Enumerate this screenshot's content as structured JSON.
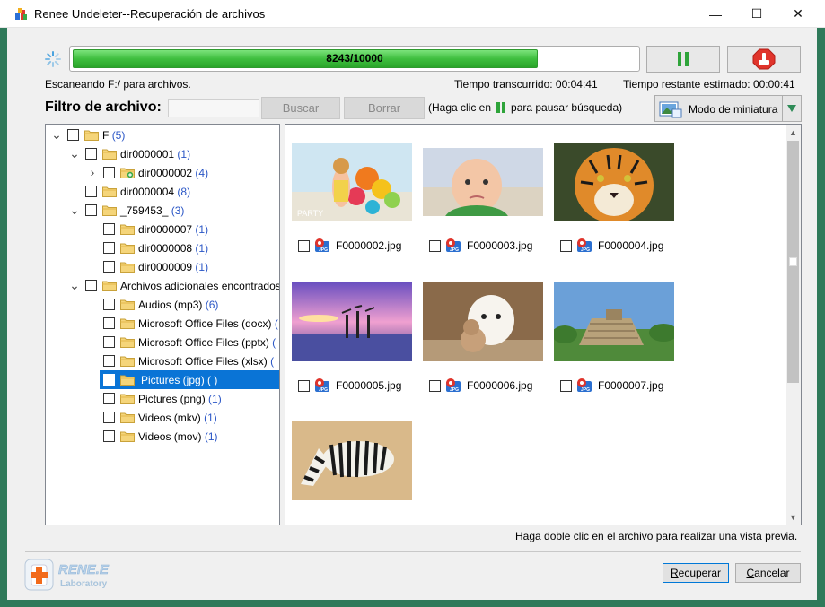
{
  "window": {
    "title": "Renee Undeleter--Recuperación de archivos",
    "minimize": "—",
    "maximize": "☐",
    "close": "✕"
  },
  "progress": {
    "text": "8243/10000",
    "value": 8243,
    "max": 10000,
    "fill_color": "#3fbf3f"
  },
  "status": {
    "scanning": "Escaneando F:/ para archivos.",
    "elapsed": "Tiempo transcurrido: 00:04:41",
    "remaining": "Tiempo restante estimado: 00:00:41"
  },
  "filter": {
    "label": "Filtro de archivo:",
    "input_value": "",
    "search_button": "Buscar",
    "clear_button": "Borrar",
    "hint_before": "(Haga clic en",
    "hint_after": "para pausar búsqueda)"
  },
  "view_mode": {
    "label": "Modo de miniatura"
  },
  "tree": [
    {
      "label": "F",
      "count": "(5)",
      "expander": "open"
    },
    {
      "label": "dir0000001",
      "count": "(1)",
      "expander": "open"
    },
    {
      "label": "dir0000002",
      "count": "(4)",
      "expander": "closed",
      "special_folder": true
    },
    {
      "label": "dir0000004",
      "count": "(8)",
      "expander": "none"
    },
    {
      "label": "_759453_",
      "count": "(3)",
      "expander": "open"
    },
    {
      "label": "dir0000007",
      "count": "(1)",
      "expander": "none"
    },
    {
      "label": "dir0000008",
      "count": "(1)",
      "expander": "none"
    },
    {
      "label": "dir0000009",
      "count": "(1)",
      "expander": "none"
    },
    {
      "label": "Archivos adicionales encontrados",
      "count": "",
      "expander": "open"
    },
    {
      "label": "Audios (mp3)",
      "count": "(6)",
      "expander": "none"
    },
    {
      "label": "Microsoft Office Files (docx)",
      "count": "(",
      "expander": "none"
    },
    {
      "label": "Microsoft Office Files (pptx)",
      "count": "(",
      "expander": "none"
    },
    {
      "label": "Microsoft Office Files (xlsx)",
      "count": "(",
      "expander": "none"
    },
    {
      "label": "Pictures (jpg)",
      "count": "( )",
      "expander": "none",
      "selected": true
    },
    {
      "label": "Pictures (png)",
      "count": "(1)",
      "expander": "none"
    },
    {
      "label": "Videos (mkv)",
      "count": "(1)",
      "expander": "none"
    },
    {
      "label": "Videos (mov)",
      "count": "(1)",
      "expander": "none"
    }
  ],
  "thumbnails": [
    {
      "name": "F0000002.jpg",
      "subject": "girl-balloons"
    },
    {
      "name": "F0000003.jpg",
      "subject": "baby"
    },
    {
      "name": "F0000004.jpg",
      "subject": "tiger"
    },
    {
      "name": "F0000005.jpg",
      "subject": "sunset-beach"
    },
    {
      "name": "F0000006.jpg",
      "subject": "puppy-kitten"
    },
    {
      "name": "F0000007.jpg",
      "subject": "pyramid"
    },
    {
      "name": "",
      "subject": "zebra"
    }
  ],
  "thumb_overlay_text": "PARTY",
  "preview_note": "Haga doble clic en el archivo para realizar una vista previa.",
  "logo": {
    "line1": "RENE.E",
    "line2": "Laboratory"
  },
  "footer": {
    "recover_prefix": "",
    "recover_underlined": "R",
    "recover_rest": "ecuperar",
    "cancel_prefix": "",
    "cancel_underlined": "C",
    "cancel_rest": "ancelar"
  }
}
